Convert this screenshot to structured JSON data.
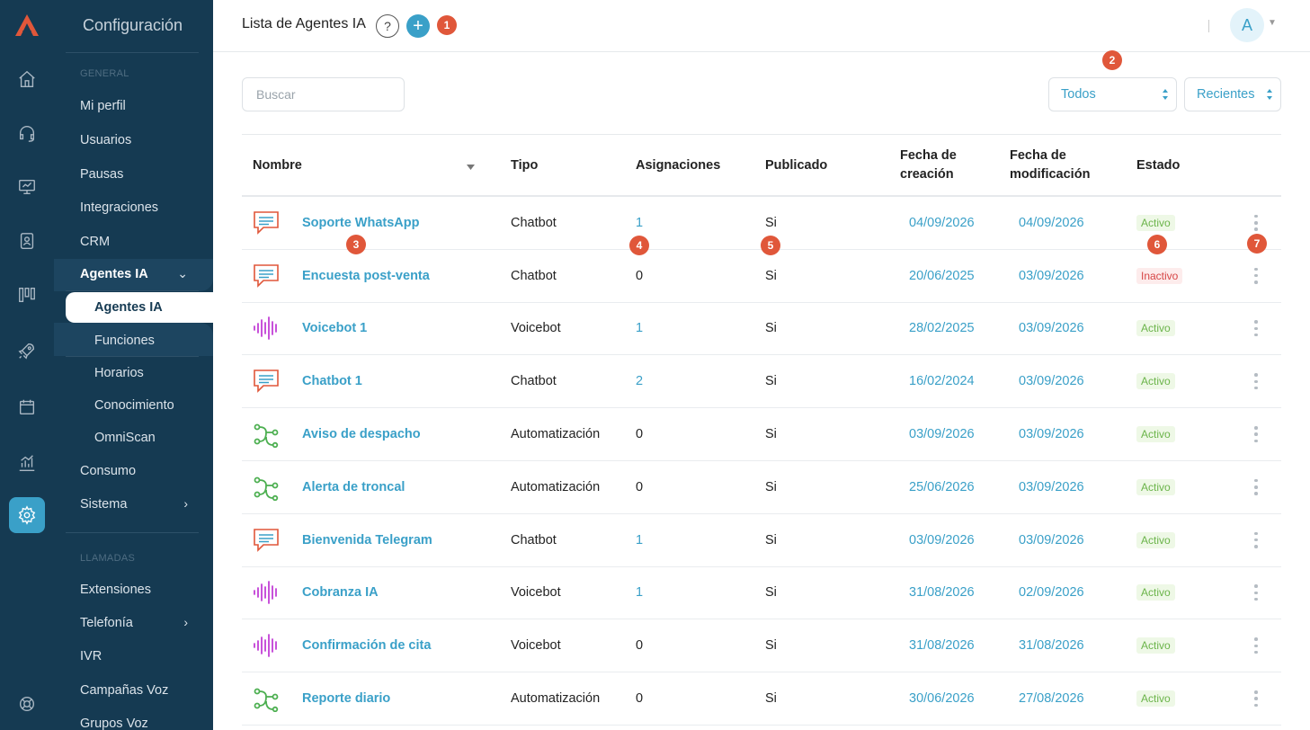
{
  "sidebar": {
    "title": "Configuración",
    "section_general": "GENERAL",
    "items_top": [
      "Mi perfil",
      "Usuarios",
      "Pausas",
      "Integraciones",
      "CRM"
    ],
    "group_label": "Agentes IA",
    "active_sub": "Agentes IA",
    "subs": [
      "Funciones",
      "Horarios",
      "Conocimiento",
      "OmniScan"
    ],
    "items_after": [
      "Consumo",
      "Sistema"
    ],
    "section_calls": "LLAMADAS",
    "items_calls": [
      "Extensiones",
      "Telefonía",
      "IVR",
      "Campañas Voz",
      "Grupos Voz"
    ]
  },
  "rail_icons": [
    "home-icon",
    "headset-icon",
    "monitor-icon",
    "contacts-icon",
    "kanban-icon",
    "rocket-icon",
    "calendar-icon",
    "chart-icon",
    "gear-icon",
    "help-circle-icon"
  ],
  "header": {
    "title": "Lista de Agentes IA",
    "help": "?",
    "plus": "+",
    "avatar": "A"
  },
  "badges": [
    "1",
    "2",
    "3",
    "4",
    "5",
    "6",
    "7"
  ],
  "filters": {
    "search_placeholder": "Buscar",
    "type_filter": "Todos",
    "sort_filter": "Recientes"
  },
  "table": {
    "headers": {
      "name": "Nombre",
      "type": "Tipo",
      "assignments": "Asignaciones",
      "published": "Publicado",
      "created_1": "Fecha de",
      "created_2": "creación",
      "modified_1": "Fecha de",
      "modified_2": "modificación",
      "status": "Estado"
    },
    "rows": [
      {
        "icon": "chat",
        "name": "Soporte WhatsApp",
        "type": "Chatbot",
        "assign": "1",
        "pub": "Si",
        "created": "04/09/2026",
        "modified": "04/09/2026",
        "status": "Activo",
        "active": true
      },
      {
        "icon": "chat",
        "name": "Encuesta post-venta",
        "type": "Chatbot",
        "assign": "0",
        "pub": "Si",
        "created": "20/06/2025",
        "modified": "03/09/2026",
        "status": "Inactivo",
        "active": false
      },
      {
        "icon": "voice",
        "name": "Voicebot 1",
        "type": "Voicebot",
        "assign": "1",
        "pub": "Si",
        "created": "28/02/2025",
        "modified": "03/09/2026",
        "status": "Activo",
        "active": true
      },
      {
        "icon": "chat",
        "name": "Chatbot 1",
        "type": "Chatbot",
        "assign": "2",
        "pub": "Si",
        "created": "16/02/2024",
        "modified": "03/09/2026",
        "status": "Activo",
        "active": true
      },
      {
        "icon": "auto",
        "name": "Aviso de despacho",
        "type": "Automatización",
        "assign": "0",
        "pub": "Si",
        "created": "03/09/2026",
        "modified": "03/09/2026",
        "status": "Activo",
        "active": true
      },
      {
        "icon": "auto",
        "name": "Alerta de troncal",
        "type": "Automatización",
        "assign": "0",
        "pub": "Si",
        "created": "25/06/2026",
        "modified": "03/09/2026",
        "status": "Activo",
        "active": true
      },
      {
        "icon": "chat",
        "name": "Bienvenida Telegram",
        "type": "Chatbot",
        "assign": "1",
        "pub": "Si",
        "created": "03/09/2026",
        "modified": "03/09/2026",
        "status": "Activo",
        "active": true
      },
      {
        "icon": "voice",
        "name": "Cobranza IA",
        "type": "Voicebot",
        "assign": "1",
        "pub": "Si",
        "created": "31/08/2026",
        "modified": "02/09/2026",
        "status": "Activo",
        "active": true
      },
      {
        "icon": "voice",
        "name": "Confirmación de cita",
        "type": "Voicebot",
        "assign": "0",
        "pub": "Si",
        "created": "31/08/2026",
        "modified": "31/08/2026",
        "status": "Activo",
        "active": true
      },
      {
        "icon": "auto",
        "name": "Reporte diario",
        "type": "Automatización",
        "assign": "0",
        "pub": "Si",
        "created": "30/06/2026",
        "modified": "27/08/2026",
        "status": "Activo",
        "active": true
      }
    ]
  },
  "colors": {
    "sidebar_bg": "#153a52",
    "accent": "#3aa0c8",
    "badge": "#e0573a",
    "chat_icon": "#e0573a",
    "voice_icon": "#c23fd6",
    "auto_icon": "#4caf50"
  }
}
